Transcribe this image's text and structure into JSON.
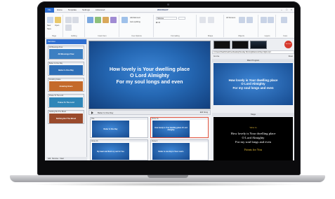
{
  "app": {
    "logo": "WORSHIP",
    "tabs": [
      {
        "label": "File"
      },
      {
        "label": "Home"
      },
      {
        "label": "Template"
      },
      {
        "label": "Settings"
      },
      {
        "label": "Advanced"
      }
    ],
    "window_controls": {
      "minimize": "–",
      "maximize": "□",
      "close": "×"
    }
  },
  "ribbon": {
    "groups": [
      {
        "label": "Page"
      },
      {
        "label": "Editing"
      },
      {
        "label": "Insert Item"
      },
      {
        "label": "Cue Options"
      },
      {
        "label": "Formatting"
      },
      {
        "label": "Shape"
      },
      {
        "label": "Objects"
      },
      {
        "label": "Layers"
      },
      {
        "label": "Cues"
      }
    ],
    "buttons": {
      "new": "New",
      "open": "Open",
      "save": "Save",
      "add_element": "Add Element",
      "auto_splitting": "Auto splitting",
      "all_screens": "All Screens"
    },
    "font_box": "Tahoma"
  },
  "left_pane": {
    "header": "Services",
    "items": [
      {
        "caption": "All Blessings Flow",
        "text": "All Blessings Flow",
        "color": "#3c7fc2"
      },
      {
        "caption": "Better Is One Day",
        "text": "Better Is One Day",
        "color": "#2f6fb8"
      },
      {
        "caption": "Amazing Grace",
        "text": "Amazing Grace",
        "color": "#c46a2a"
      },
      {
        "caption": "Praise To The Lord",
        "text": "Praise To The Lord",
        "color": "#2f86b8"
      },
      {
        "caption": "Nothing But The Blood",
        "text": "Nothing But The Blood",
        "color": "#9a4a2c"
      }
    ],
    "footer": [
      "Add",
      "Remove",
      "Clear"
    ]
  },
  "main_preview": {
    "lines": [
      "How lovely is Your dwelling place",
      "O Lord Almighty",
      "For my soul longs and even"
    ]
  },
  "play_bar": {
    "song": "Better Is One Day",
    "edit": "Edit Song"
  },
  "slides": [
    {
      "caption": "Title",
      "text": "Better Is One Day",
      "selected": false
    },
    {
      "caption": "Verse 1a",
      "text": "How lovely is Your dwelling place O Lord Almighty",
      "selected": true
    },
    {
      "caption": "Verse 1b",
      "text": "My heart and flesh cry out for You",
      "selected": false
    },
    {
      "caption": "Verse 2",
      "text": "Better is one day in Your courts",
      "selected": false
    }
  ],
  "right_pane": {
    "live_button": "Go Live",
    "path": "C:\\Users\\Heath\\OneDrive\\Desktop\\Sunday Morning\\Diamond Ray Flight.mp4",
    "controls": {
      "left": "Go Live",
      "right": "Reset"
    },
    "main_program_label": "Main Program",
    "main_program_lines": [
      "How lovely is Your dwelling place",
      "O Lord Almighty",
      "For my soul longs and even"
    ],
    "stage_label": "Stage",
    "stage_title": "Verse 1a",
    "stage_lines": [
      "How lovely is Your dwelling place",
      "O Lord Almighty",
      "For my soul longs and even"
    ],
    "stage_next": "Faints for You"
  }
}
